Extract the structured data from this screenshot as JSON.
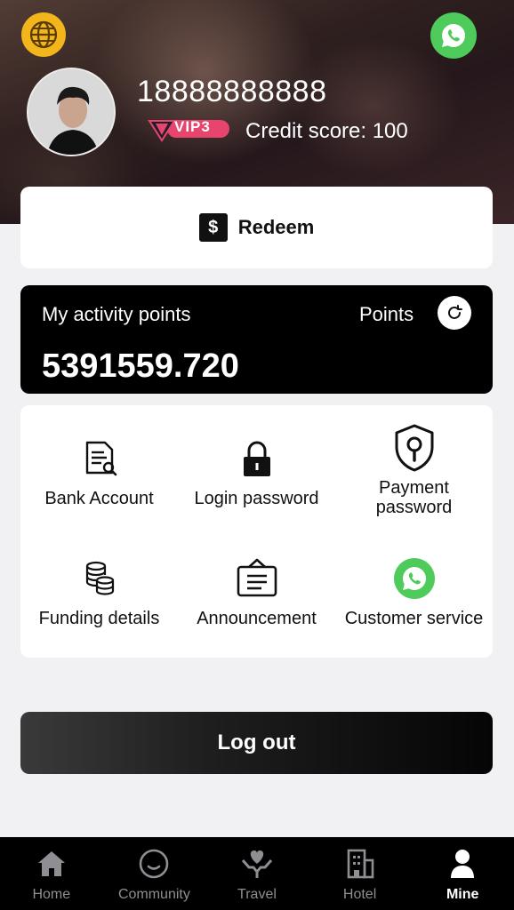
{
  "header": {
    "username": "18888888888",
    "vip_label": "VIP3",
    "credit_score": "Credit score: 100"
  },
  "redeem": {
    "label": "Redeem",
    "icon": "dollar-icon"
  },
  "points": {
    "title": "My activity points",
    "points_label": "Points",
    "value": "5391559.720"
  },
  "menu": {
    "items": [
      {
        "label": "Bank Account",
        "icon": "document-icon"
      },
      {
        "label": "Login password",
        "icon": "lock-icon"
      },
      {
        "label": "Payment\npassword",
        "icon": "shield-key-icon"
      },
      {
        "label": "Funding details",
        "icon": "coins-icon"
      },
      {
        "label": "Announcement",
        "icon": "notice-board-icon"
      },
      {
        "label": "Customer service",
        "icon": "whatsapp-icon"
      }
    ]
  },
  "logout_label": "Log out",
  "tabs": [
    {
      "label": "Home",
      "icon": "home-icon"
    },
    {
      "label": "Community",
      "icon": "smile-icon"
    },
    {
      "label": "Travel",
      "icon": "travel-heart-icon"
    },
    {
      "label": "Hotel",
      "icon": "building-icon"
    },
    {
      "label": "Mine",
      "icon": "person-icon",
      "active": true
    }
  ],
  "colors": {
    "accent_yellow": "#f2b51c",
    "whatsapp_green": "#4ecb5b",
    "vip_pink": "#e8456e"
  }
}
